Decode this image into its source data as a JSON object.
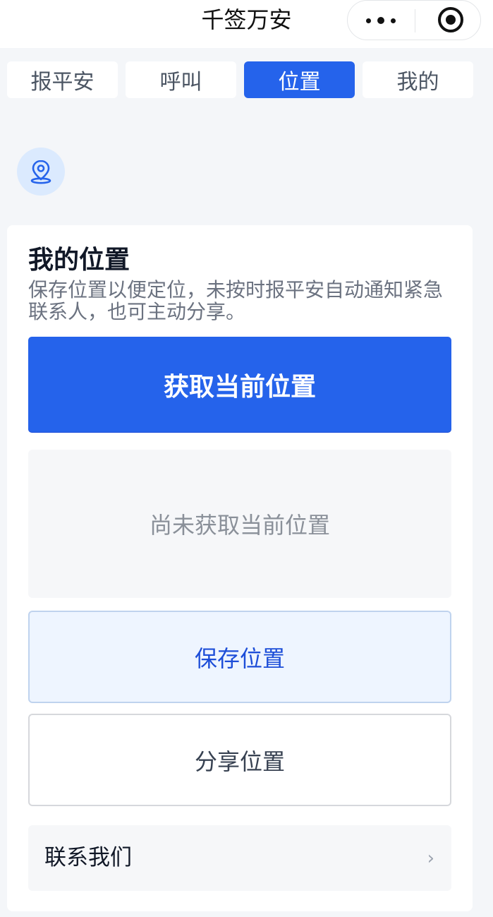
{
  "navbar": {
    "title": "千签万安",
    "more_icon": "more-dots-icon",
    "close_icon": "target-close-icon"
  },
  "tabs": [
    {
      "label": "报平安",
      "active": false
    },
    {
      "label": "呼叫",
      "active": false
    },
    {
      "label": "位置",
      "active": true
    },
    {
      "label": "我的",
      "active": false
    }
  ],
  "location_badge": {
    "icon": "map-pin-icon"
  },
  "card": {
    "title": "我的位置",
    "description": "保存位置以便定位，未按时报平安自动通知紧急联系人，也可主动分享。",
    "get_location_label": "获取当前位置",
    "location_status": "尚未获取当前位置",
    "save_label": "保存位置",
    "share_label": "分享位置",
    "contact_label": "联系我们",
    "chevron": "›"
  },
  "colors": {
    "accent": "#2563eb",
    "background": "#f4f6f9",
    "save_bg": "#eef5ff"
  }
}
